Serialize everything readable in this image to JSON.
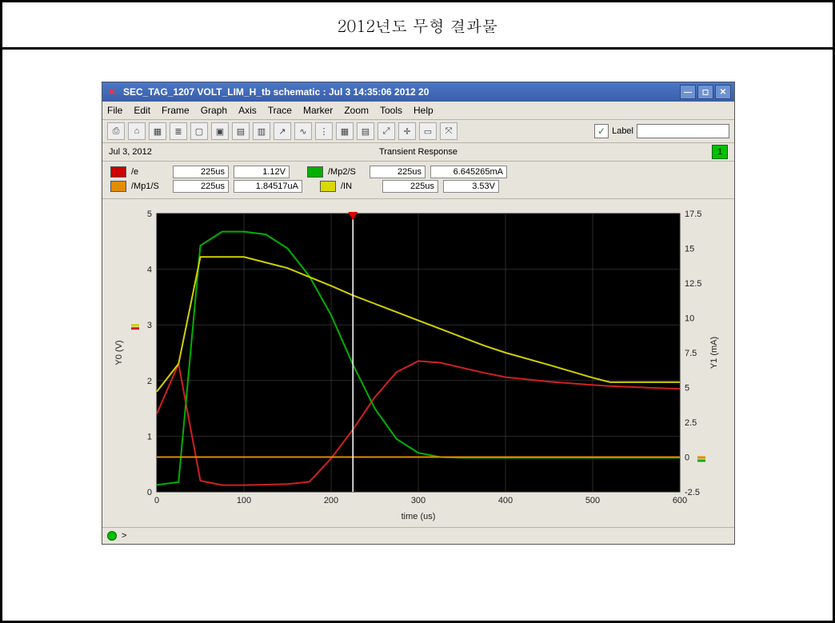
{
  "page": {
    "header": "2012년도 무형 결과물"
  },
  "window": {
    "title": "SEC_TAG_1207 VOLT_LIM_H_tb schematic : Jul  3 14:35:06 2012 20"
  },
  "menu": {
    "file": "File",
    "edit": "Edit",
    "frame": "Frame",
    "graph": "Graph",
    "axis": "Axis",
    "trace": "Trace",
    "marker": "Marker",
    "zoom": "Zoom",
    "tools": "Tools",
    "help": "Help"
  },
  "toolbar": {
    "label_text": "Label",
    "label_value": ""
  },
  "info": {
    "date": "Jul 3, 2012",
    "center": "Transient Response",
    "right": "1"
  },
  "readouts": {
    "r1": {
      "name": "/e",
      "time": "225us",
      "val": "1.12V"
    },
    "r2": {
      "name": "/Mp2/S",
      "time": "225us",
      "val": "6.645265mA"
    },
    "r3": {
      "name": "/Mp1/S",
      "time": "225us",
      "val": "1.84517uA"
    },
    "r4": {
      "name": "/IN",
      "time": "225us",
      "val": "3.53V"
    }
  },
  "axes": {
    "xlabel": "time (us)",
    "y0label": "Y0 (V)",
    "y1label": "Y1 (mA)"
  },
  "status": {
    "prompt": ">"
  },
  "chart_data": {
    "type": "line",
    "title": "Transient Response",
    "xlabel": "time (us)",
    "x": [
      0,
      25,
      50,
      75,
      100,
      125,
      150,
      175,
      200,
      225,
      250,
      275,
      300,
      325,
      350,
      375,
      400,
      450,
      500,
      520,
      550,
      600
    ],
    "y0": {
      "label": "Y0 (V)",
      "lim": [
        0,
        5
      ],
      "ticks": [
        0,
        1,
        2,
        3,
        4,
        5
      ]
    },
    "y1": {
      "label": "Y1 (mA)",
      "lim": [
        -2.5,
        17.5
      ],
      "ticks": [
        -2.5,
        0,
        2.5,
        5.0,
        7.5,
        10.0,
        12.5,
        15.0,
        17.5
      ]
    },
    "xlim": [
      0,
      600
    ],
    "xticks": [
      0,
      100,
      200,
      300,
      400,
      500,
      600
    ],
    "cursor_x": 225,
    "series": [
      {
        "name": "/e",
        "axis": "y0",
        "color": "#d02020",
        "values": [
          1.4,
          2.3,
          0.2,
          0.12,
          0.12,
          0.13,
          0.14,
          0.18,
          0.6,
          1.12,
          1.7,
          2.15,
          2.35,
          2.32,
          2.23,
          2.14,
          2.06,
          1.98,
          1.92,
          1.9,
          1.88,
          1.85
        ]
      },
      {
        "name": "/Mp2/S",
        "axis": "y1",
        "color": "#00b000",
        "values": [
          -2.0,
          -1.8,
          15.2,
          16.2,
          16.2,
          16.0,
          15.0,
          13.0,
          10.2,
          6.65,
          3.5,
          1.3,
          0.3,
          0.0,
          -0.05,
          -0.05,
          -0.05,
          -0.05,
          -0.05,
          -0.05,
          -0.05,
          -0.05
        ]
      },
      {
        "name": "/Mp1/S",
        "axis": "y1",
        "color": "#e28c00",
        "values": [
          0.0,
          0.0,
          0.0,
          0.0,
          0.0,
          0.0,
          0.0,
          0.0,
          0.0,
          0.0,
          0.0,
          0.0,
          0.0,
          0.0,
          0.0,
          0.0,
          0.0,
          0.0,
          0.0,
          0.0,
          0.0,
          0.0
        ]
      },
      {
        "name": "/IN",
        "axis": "y0",
        "color": "#d0d000",
        "values": [
          1.8,
          2.3,
          4.22,
          4.22,
          4.22,
          4.12,
          4.02,
          3.86,
          3.7,
          3.53,
          3.38,
          3.23,
          3.08,
          2.93,
          2.78,
          2.63,
          2.5,
          2.28,
          2.05,
          1.97,
          1.97,
          1.97
        ]
      }
    ]
  }
}
